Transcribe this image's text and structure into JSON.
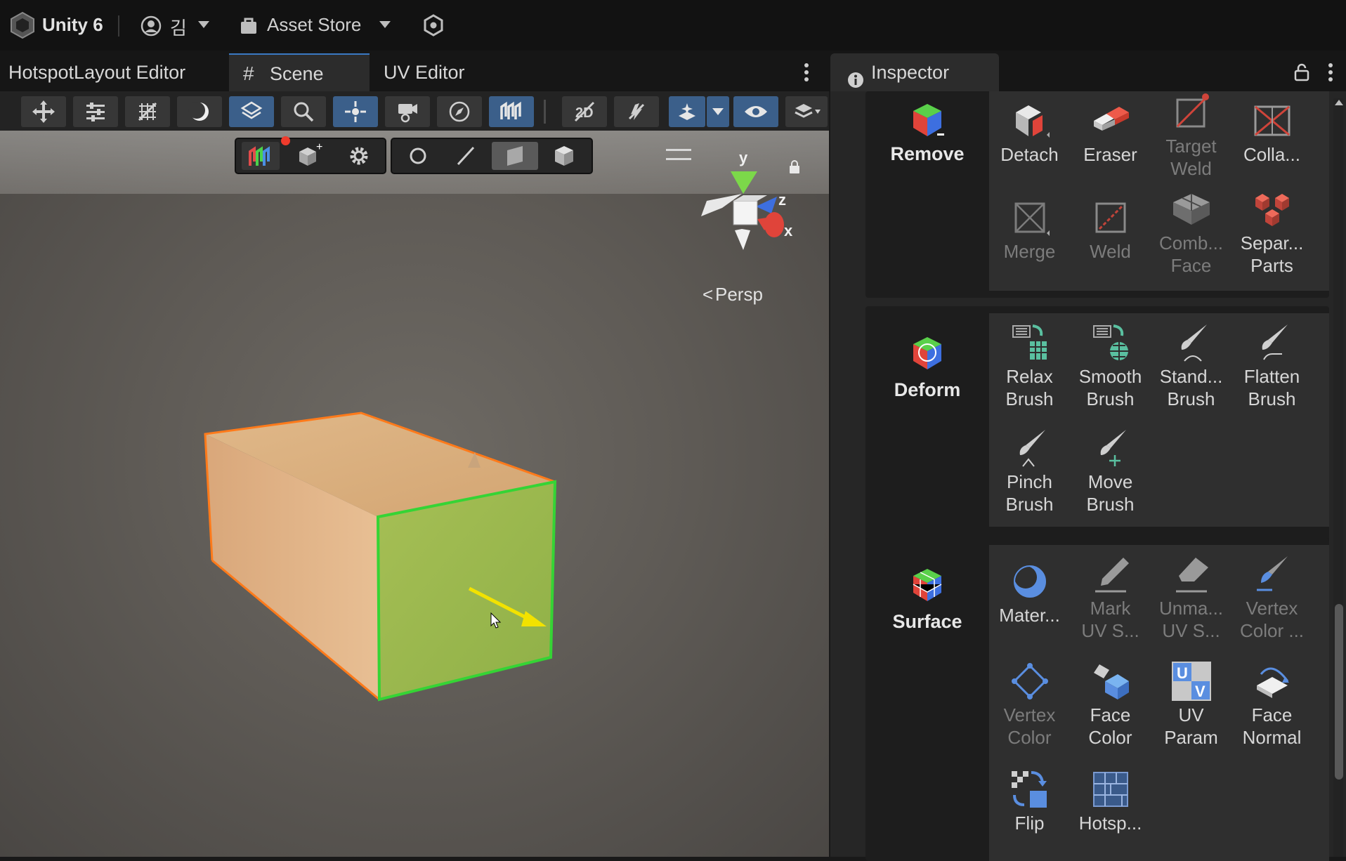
{
  "topbar": {
    "app_name": "Unity 6",
    "account_name": "김",
    "asset_store": "Asset Store"
  },
  "tabs": [
    {
      "label": "HotspotLayout Editor"
    },
    {
      "label": "Scene"
    },
    {
      "label": "UV Editor"
    }
  ],
  "inspector_tab": {
    "label": "Inspector"
  },
  "scene": {
    "projection_label": "Persp",
    "axes": {
      "y": "y",
      "z": "z",
      "x": "x"
    }
  },
  "sections": {
    "remove": {
      "label": "Remove",
      "tools": [
        {
          "label": "Detach",
          "enabled": true
        },
        {
          "label": "Eraser",
          "enabled": true
        },
        {
          "label": "Target\nWeld",
          "enabled": false
        },
        {
          "label": "Colla...",
          "enabled": true
        },
        {
          "label": "Merge",
          "enabled": false
        },
        {
          "label": "Weld",
          "enabled": false
        },
        {
          "label": "Comb...\nFace",
          "enabled": false
        },
        {
          "label": "Separ...\nParts",
          "enabled": true
        }
      ]
    },
    "deform": {
      "label": "Deform",
      "tools": [
        {
          "label": "Relax\nBrush",
          "enabled": true
        },
        {
          "label": "Smooth\nBrush",
          "enabled": true
        },
        {
          "label": "Stand...\nBrush",
          "enabled": true
        },
        {
          "label": "Flatten\nBrush",
          "enabled": true
        },
        {
          "label": "Pinch\nBrush",
          "enabled": true
        },
        {
          "label": "Move\nBrush",
          "enabled": true
        }
      ]
    },
    "surface": {
      "label": "Surface",
      "tools": [
        {
          "label": "Mater...",
          "enabled": true
        },
        {
          "label": "Mark\nUV S...",
          "enabled": false
        },
        {
          "label": "Unma...\nUV S...",
          "enabled": false
        },
        {
          "label": "Vertex\nColor ...",
          "enabled": false
        },
        {
          "label": "Vertex\nColor",
          "enabled": false
        },
        {
          "label": "Face\nColor",
          "enabled": true
        },
        {
          "label": "UV\nParam",
          "enabled": true
        },
        {
          "label": "Face\nNormal",
          "enabled": true
        },
        {
          "label": "Flip",
          "enabled": true
        },
        {
          "label": "Hotsp...",
          "enabled": true
        }
      ]
    }
  },
  "colors": {
    "accent_blue": "#3b5f8a",
    "selection_orange": "#ff7a1a",
    "selection_green": "#35d435",
    "gizmo_yellow": "#f2e200"
  }
}
